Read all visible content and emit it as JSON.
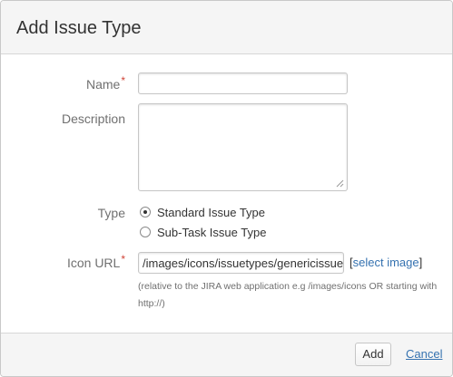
{
  "dialog": {
    "title": "Add Issue Type"
  },
  "form": {
    "name": {
      "label": "Name",
      "required_mark": "*",
      "value": ""
    },
    "description": {
      "label": "Description",
      "value": ""
    },
    "type": {
      "label": "Type",
      "options": [
        {
          "label": "Standard Issue Type",
          "selected": true
        },
        {
          "label": "Sub-Task Issue Type",
          "selected": false
        }
      ]
    },
    "icon_url": {
      "label": "Icon URL",
      "required_mark": "*",
      "value": "/images/icons/issuetypes/genericissue",
      "link_open": "[",
      "link_text": "select image",
      "link_close": "]",
      "help": "(relative to the JIRA web application e.g /images/icons OR starting with http://)"
    }
  },
  "footer": {
    "add_label": "Add",
    "cancel_label": "Cancel"
  },
  "colors": {
    "required": "#d04437",
    "link": "#3572b0"
  }
}
